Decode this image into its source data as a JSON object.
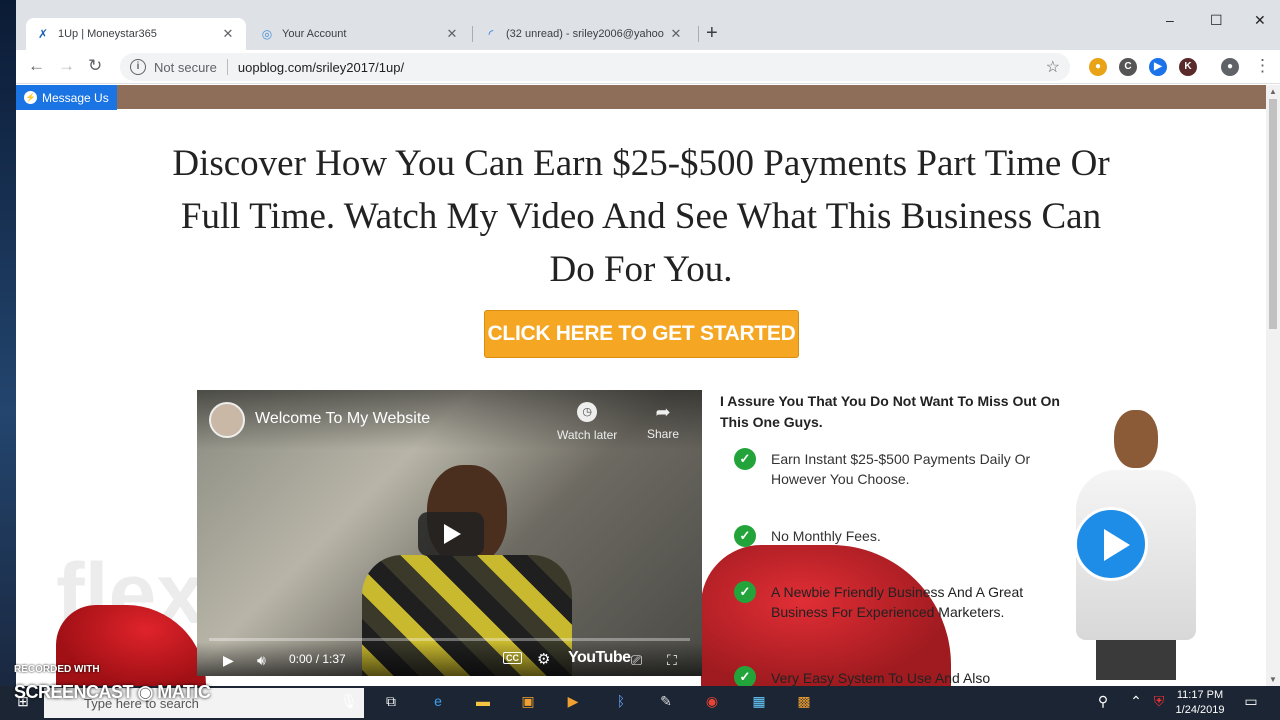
{
  "browser": {
    "tabs": [
      {
        "title": "1Up | Moneystar365",
        "active": true
      },
      {
        "title": "Your Account",
        "active": false
      },
      {
        "title": "(32 unread) - sriley2006@yahoo",
        "active": false
      }
    ],
    "new_tab": "+",
    "window_controls": {
      "minimize": "–",
      "maximize": "☐",
      "close": "✕"
    },
    "security_label": "Not secure",
    "url": "uopblog.com/sriley2017/1up/"
  },
  "page": {
    "message_button": "Message Us",
    "headline": "Discover How You Can Earn $25-$500 Payments Part Time Or Full Time. Watch My Video And See What This Business Can Do For You.",
    "cta": "CLICK HERE TO GET STARTED",
    "video": {
      "title": "Welcome To My Website",
      "watch_later": "Watch later",
      "share": "Share",
      "time": "0:00 / 1:37",
      "cc": "CC",
      "youtube": "YouTube"
    },
    "assure": "I Assure You That You Do Not Want To Miss Out On This One Guys.",
    "features": [
      "Earn Instant $25-$500 Payments Daily Or However You Choose.",
      "No Monthly Fees.",
      "A Newbie Friendly Business And A Great Business For Experienced Marketers.",
      "Very Easy System To Use And Also"
    ],
    "watermark": "flex"
  },
  "taskbar": {
    "search_placeholder": "Type here to search",
    "time": "11:17 PM",
    "date": "1/24/2019"
  },
  "recorder": {
    "label_small": "RECORDED WITH",
    "label_big": "SCREENCAST ◉ MATIC"
  },
  "colors": {
    "cta_bg": "#f5a623",
    "check_green": "#23a43a",
    "messenger_blue": "#1b74e4",
    "brown_bar": "#8e6e58"
  }
}
